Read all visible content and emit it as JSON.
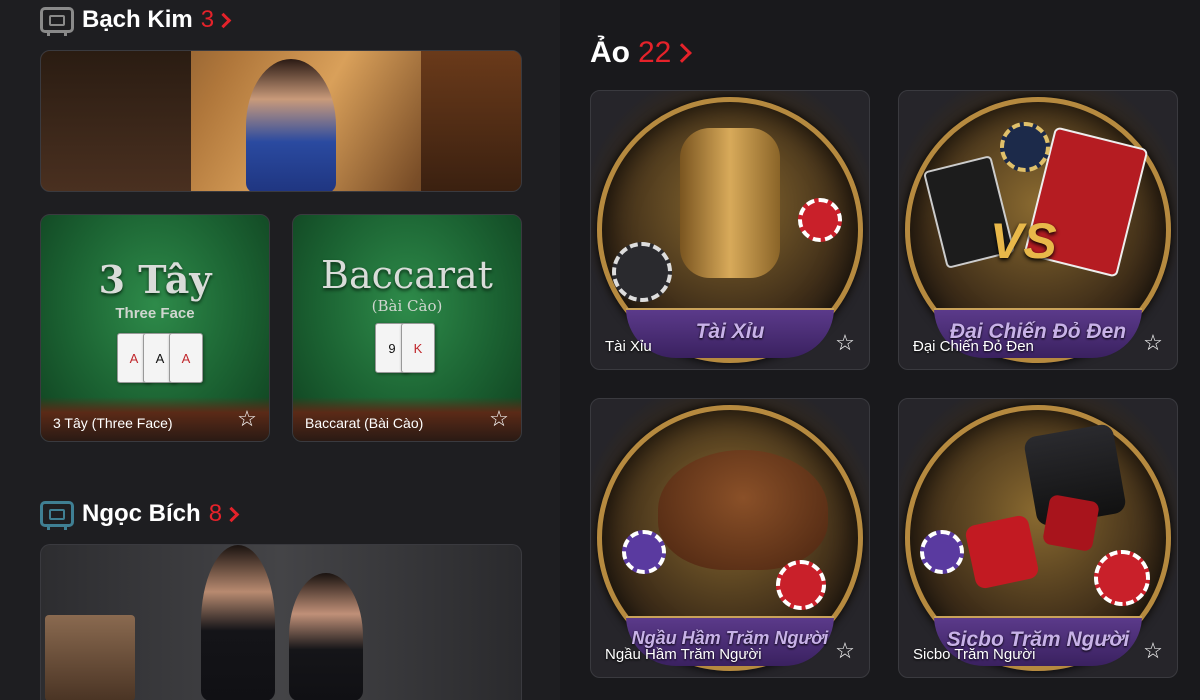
{
  "sections": {
    "bach_kim": {
      "title": "Bạch Kim",
      "count": "3"
    },
    "ngoc_bich": {
      "title": "Ngọc Bích",
      "count": "8"
    },
    "ao": {
      "title": "Ảo",
      "count": "22"
    }
  },
  "bach_kim_tiles": [
    {
      "big": "3 Tây",
      "sub": "Three Face",
      "label": "3 Tây (Three Face)"
    },
    {
      "big": "Baccarat",
      "sub": "(Bài Cào)",
      "label": "Baccarat (Bài Cào)"
    }
  ],
  "ao_games": [
    {
      "ribbon": "Tài Xỉu",
      "label": "Tài Xỉu"
    },
    {
      "ribbon": "Đại Chiến Đỏ Đen",
      "label": "Đại Chiến Đỏ Đen"
    },
    {
      "ribbon": "Ngầu Hầm Trăm Người",
      "label": "Ngầu Hầm Trăm Người"
    },
    {
      "ribbon": "Sicbo Trăm Người",
      "label": "Sicbo Trăm Người"
    }
  ],
  "icons": {
    "favorite": "star-outline",
    "section": "sofa-icon",
    "more": "chevron-right"
  },
  "colors": {
    "accent": "#e5222a",
    "background": "#1c1c1f"
  }
}
